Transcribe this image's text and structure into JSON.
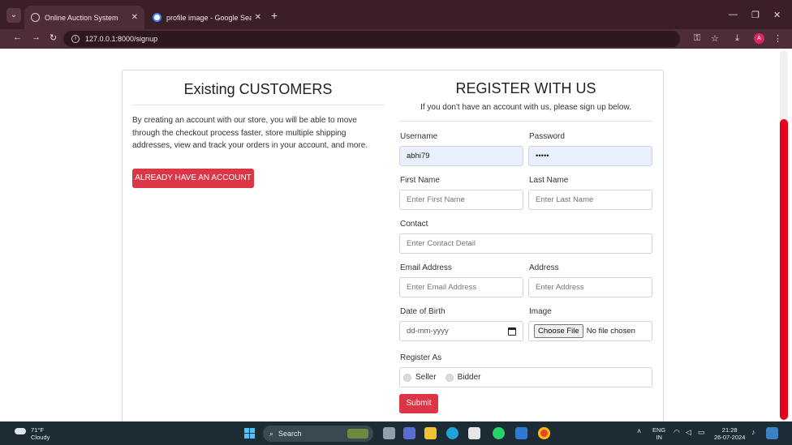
{
  "browser": {
    "tabs": [
      {
        "title": "Online Auction System",
        "active": true
      },
      {
        "title": "profile image - Google Search",
        "active": false
      }
    ],
    "url": "127.0.0.1:8000/signup",
    "profile_initial": "A"
  },
  "left": {
    "title": "Existing CUSTOMERS",
    "description": "By creating an account with our store, you will be able to move through the checkout process faster, store multiple shipping addresses, view and track your orders in your account, and more.",
    "button_label": "ALREADY HAVE AN ACCOUNT"
  },
  "form": {
    "title": "REGISTER WITH US",
    "subtitle": "If you don't have an account with us, please sign up below.",
    "username": {
      "label": "Username",
      "value": "abhi79"
    },
    "password": {
      "label": "Password",
      "value": "•••••"
    },
    "first_name": {
      "label": "First Name",
      "placeholder": "Enter First Name"
    },
    "last_name": {
      "label": "Last Name",
      "placeholder": "Enter Last Name"
    },
    "contact": {
      "label": "Contact",
      "placeholder": "Enter Contact Detail"
    },
    "email": {
      "label": "Email Address",
      "placeholder": "Enter Email Address"
    },
    "address": {
      "label": "Address",
      "placeholder": "Enter Address"
    },
    "dob": {
      "label": "Date of Birth",
      "placeholder": "dd-mm-yyyy"
    },
    "image": {
      "label": "Image",
      "button": "Choose File",
      "status": "No file chosen"
    },
    "register_as": {
      "label": "Register As",
      "options": [
        "Seller",
        "Bidder"
      ]
    },
    "submit_label": "Submit"
  },
  "taskbar": {
    "weather_temp": "71°F",
    "weather_desc": "Cloudy",
    "search_label": "Search",
    "lang_top": "ENG",
    "lang_bottom": "IN",
    "time": "21:28",
    "date": "26-07-2024"
  },
  "colors": {
    "accent": "#dc3545",
    "tab_bar": "#3a1e28",
    "scroll_thumb": "#e8001c"
  }
}
